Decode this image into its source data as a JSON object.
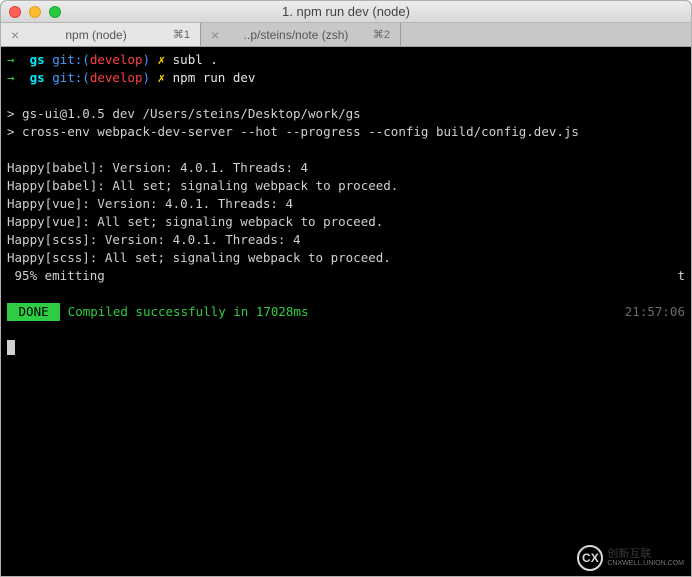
{
  "titlebar": {
    "title": "1. npm run dev (node)"
  },
  "tabs": [
    {
      "label": "npm (node)",
      "shortcut": "⌘1",
      "active": true
    },
    {
      "label": "..p/steins/note (zsh)",
      "shortcut": "⌘2",
      "active": false
    }
  ],
  "prompt": {
    "arrow": "→",
    "host": "gs",
    "git_label": "git:",
    "branch": "develop",
    "symbol": "✗"
  },
  "commands": [
    "subl .",
    "npm run dev"
  ],
  "output": {
    "line_dev": "> gs-ui@1.0.5 dev /Users/steins/Desktop/work/gs",
    "line_cross": "> cross-env webpack-dev-server --hot --progress --config build/config.dev.js",
    "happy": [
      "Happy[babel]: Version: 4.0.1. Threads: 4",
      "Happy[babel]: All set; signaling webpack to proceed.",
      "Happy[vue]: Version: 4.0.1. Threads: 4",
      "Happy[vue]: All set; signaling webpack to proceed.",
      "Happy[scss]: Version: 4.0.1. Threads: 4",
      "Happy[scss]: All set; signaling webpack to proceed."
    ],
    "progress": " 95% emitting",
    "progress_right": "t",
    "done_badge": " DONE ",
    "done_msg": " Compiled successfully in 17028ms",
    "timestamp": "21:57:06"
  },
  "watermark": {
    "badge": "CX",
    "text": "创新互联",
    "sub": "CNXWELL.UNION.COM"
  }
}
